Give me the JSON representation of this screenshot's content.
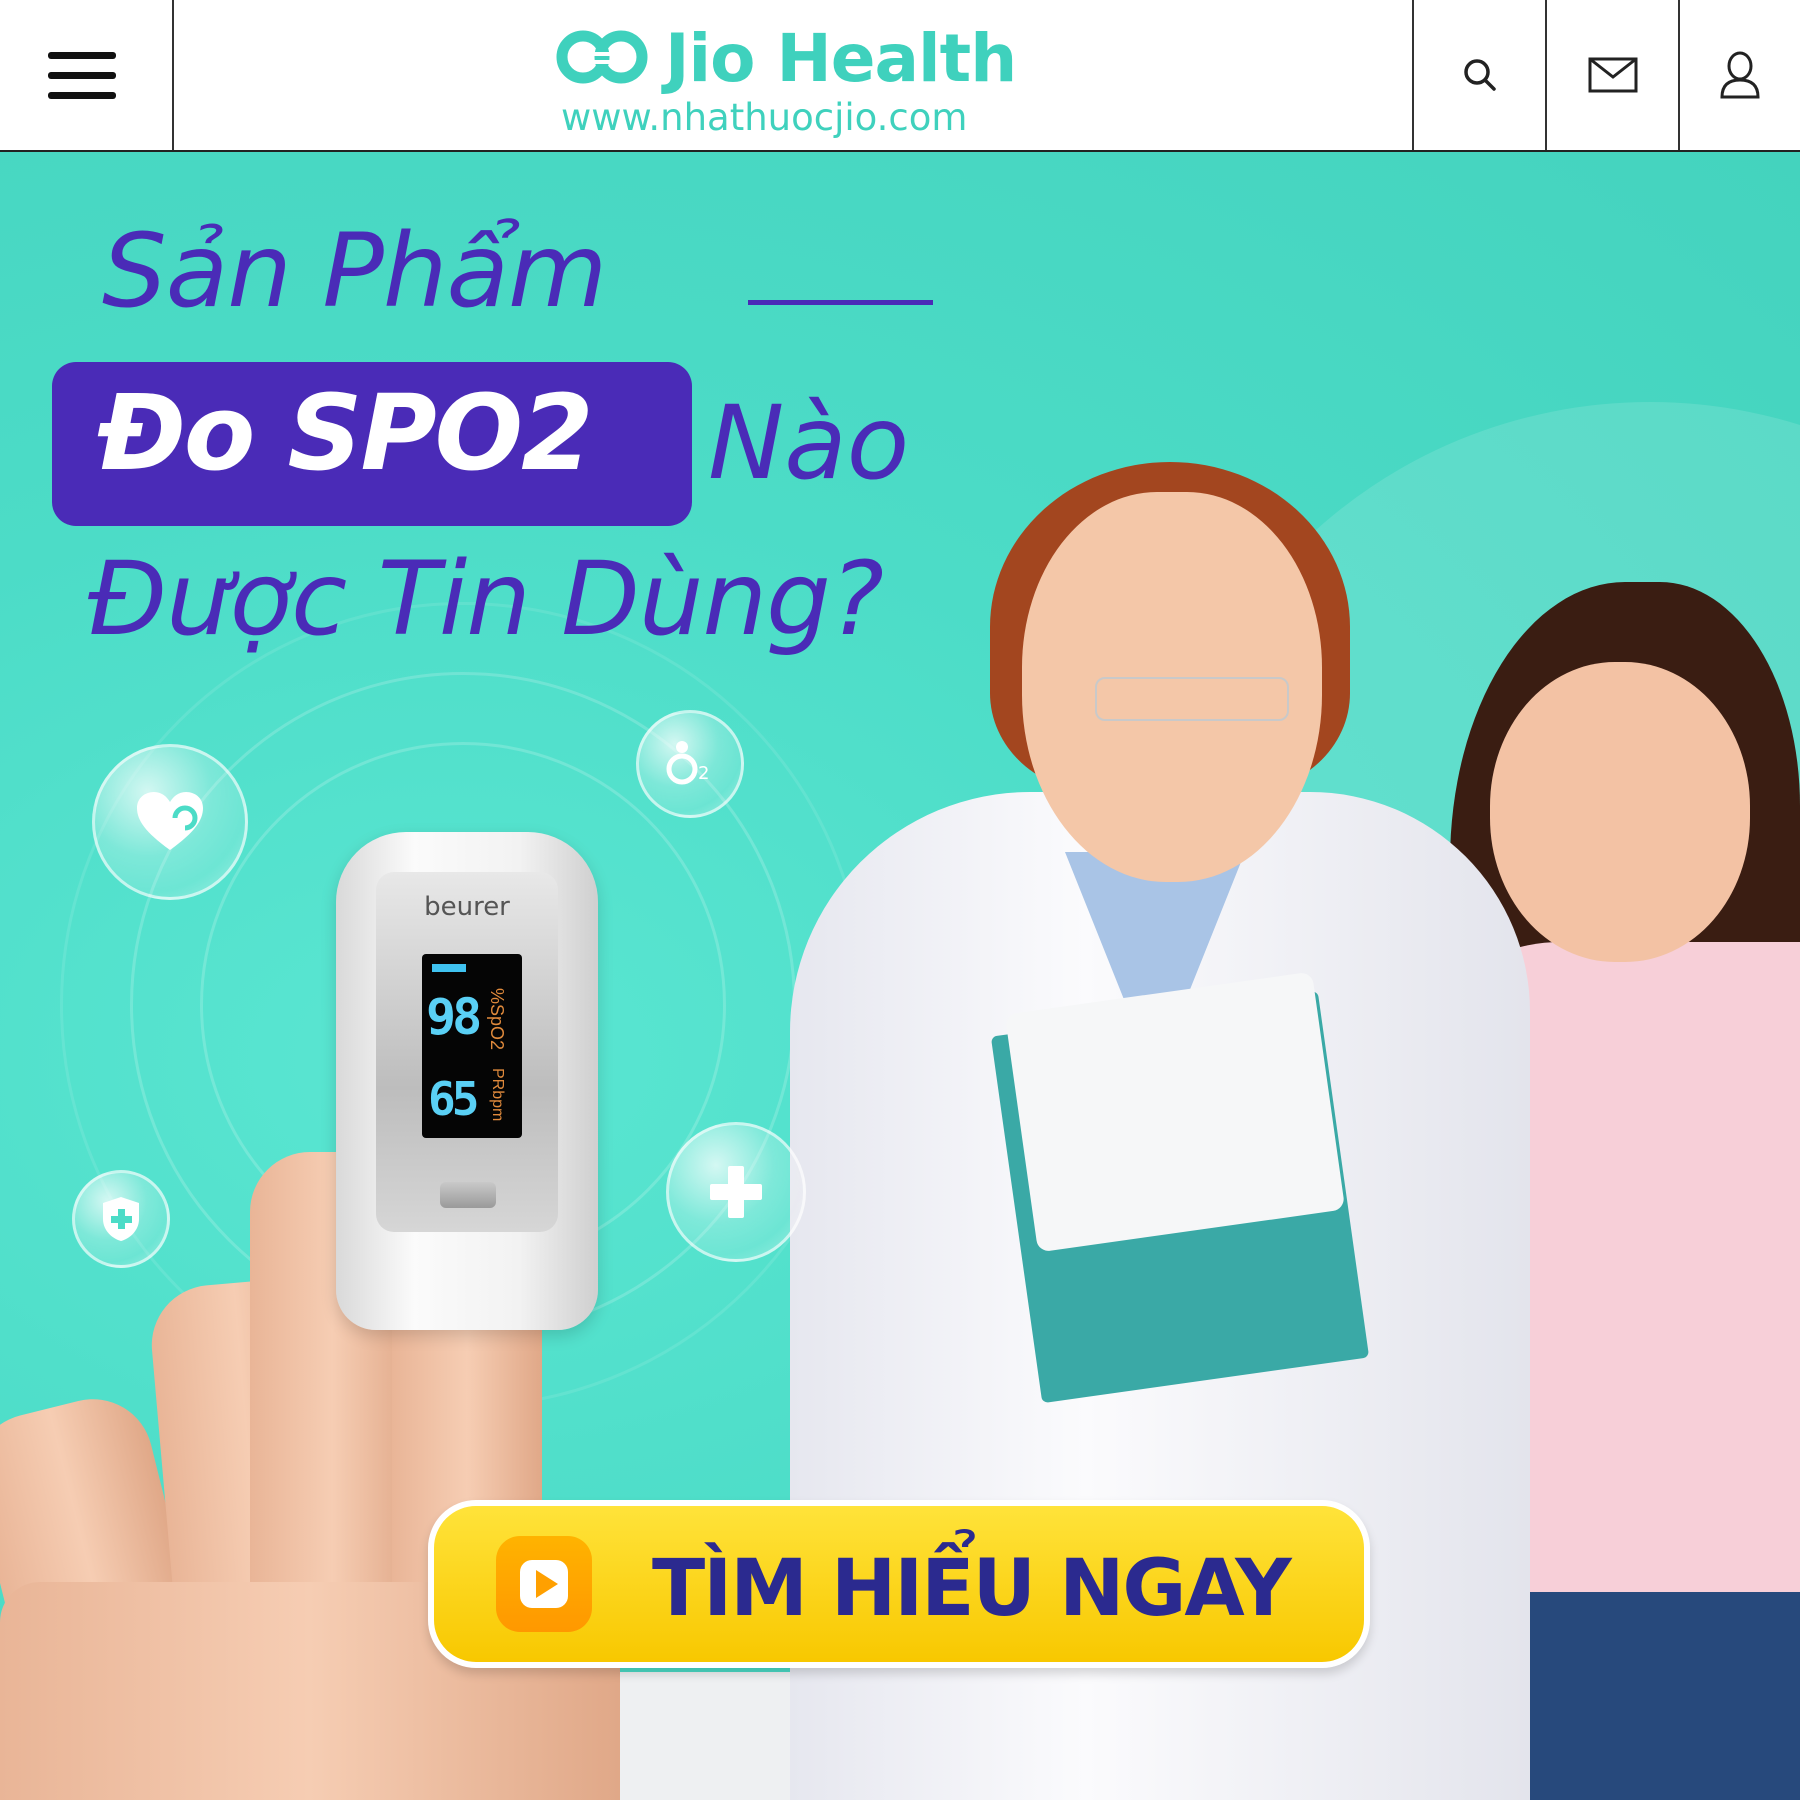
{
  "header": {
    "menu_icon": "hamburger-menu-icon",
    "logo": {
      "title": "Jio Health",
      "url": "www.nhathuocjio.com",
      "brand_color": "#3fd1bd"
    },
    "actions": {
      "search_icon": "search-icon",
      "mail_icon": "mail-icon",
      "user_icon": "user-icon"
    }
  },
  "hero": {
    "headline": {
      "line1": "Sản Phẩm",
      "highlight": "Đo SPO2",
      "line2_rest": "Nào",
      "line3": "Được Tin Dùng?"
    },
    "device": {
      "brand": "beurer",
      "spo2_value": "98",
      "spo2_label": "%SpO2",
      "pr_value": "65",
      "pr_label": "PRbpm"
    },
    "bubble_icons": [
      "heart-icon",
      "oxygen-icon",
      "shield-plus-icon",
      "medical-plus-icon"
    ],
    "cta": {
      "label": "TÌM HIỂU NGAY",
      "icon": "play-icon"
    },
    "colors": {
      "background": "#4cdcc7",
      "headline": "#4a2bb7",
      "cta_background": "#fcd20c",
      "cta_text": "#2b2a8f"
    }
  }
}
